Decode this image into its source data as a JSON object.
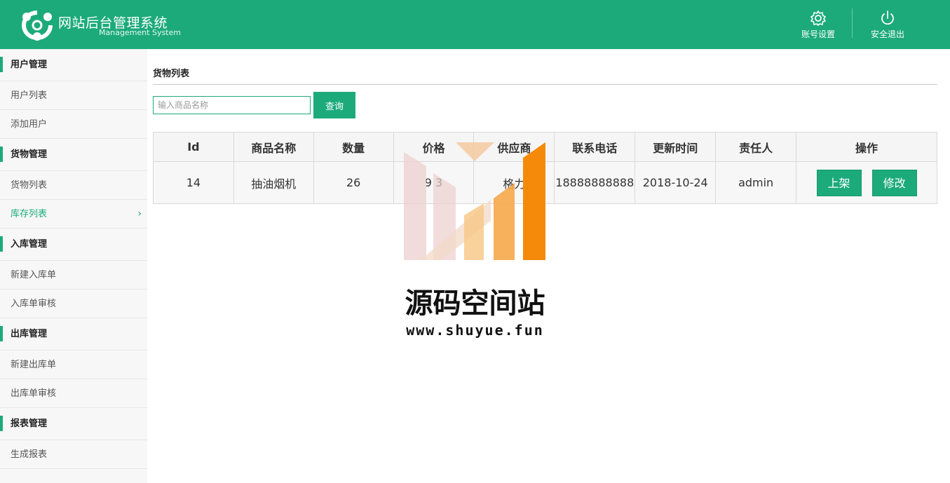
{
  "header": {
    "title": "网站后台管理系统",
    "subtitle": "Management System",
    "account_label": "账号设置",
    "logout_label": "安全退出",
    "icons": {
      "logo": "share-nodes-logo",
      "account": "gear-icon",
      "logout": "power-icon"
    },
    "bg_color": "#1caa7b"
  },
  "sidebar": {
    "groups": [
      {
        "label": "用户管理",
        "items": [
          "用户列表",
          "添加用户"
        ]
      },
      {
        "label": "货物管理",
        "items": [
          "货物列表",
          "库存列表"
        ]
      },
      {
        "label": "入库管理",
        "items": [
          "新建入库单",
          "入库单审核"
        ]
      },
      {
        "label": "出库管理",
        "items": [
          "新建出库单",
          "出库单审核"
        ]
      },
      {
        "label": "报表管理",
        "items": [
          "生成报表"
        ]
      }
    ],
    "active_item": "库存列表"
  },
  "main": {
    "title": "货物列表",
    "search": {
      "placeholder": "输入商品名称",
      "value": "",
      "button_label": "查询"
    },
    "table": {
      "columns": [
        "Id",
        "商品名称",
        "数量",
        "价格",
        "供应商",
        "联系电话",
        "更新时间",
        "责任人",
        "操作"
      ],
      "rows": [
        {
          "id": "14",
          "name": "抽油烟机",
          "qty": "26",
          "price": "9 3",
          "supplier": "格力",
          "phone": "18888888888",
          "updated": "2018-10-24",
          "owner": "admin",
          "actions": [
            "上架",
            "修改"
          ]
        }
      ]
    }
  },
  "watermark": {
    "title": "源码空间站",
    "url": "www.shuyue.fun"
  }
}
